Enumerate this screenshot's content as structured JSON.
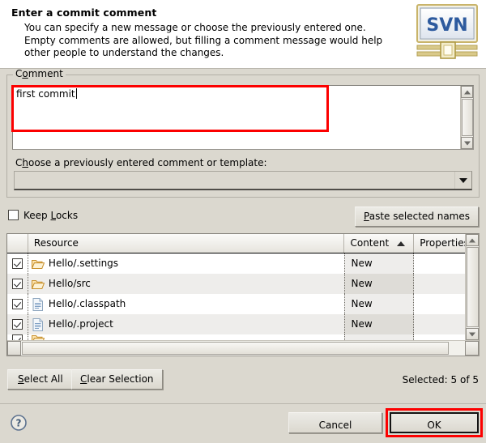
{
  "dialog": {
    "title": "Enter a commit comment",
    "description_lines": [
      "You can specify a new message or choose the previously entered one.",
      "Empty comments are allowed, but filling a comment message would help",
      "other people to understand the changes."
    ],
    "logo_text": "SVN"
  },
  "comment_group": {
    "label_pre": "C",
    "label_mnemonic": "o",
    "label_post": "mment",
    "label_full": "Comment",
    "value": "first commit"
  },
  "choose": {
    "label_pre": "C",
    "label_mnemonic": "h",
    "label_post": "oose a previously entered comment or template:",
    "label_full": "Choose a previously entered comment or template:",
    "selected_value": ""
  },
  "keep_locks": {
    "label_pre": "Keep ",
    "label_mnemonic": "L",
    "label_post": "ocks",
    "label_full": "Keep Locks",
    "checked": false
  },
  "paste_button": {
    "label_pre": "",
    "label_mnemonic": "P",
    "label_post": "aste selected names",
    "label_full": "Paste selected names"
  },
  "table": {
    "columns": [
      {
        "key": "check",
        "label": ""
      },
      {
        "key": "resource",
        "label": "Resource"
      },
      {
        "key": "content",
        "label": "Content",
        "sorted": "asc"
      },
      {
        "key": "properties",
        "label": "Properties"
      }
    ],
    "rows": [
      {
        "checked": true,
        "icon": "folder-icon",
        "resource": "Hello/.settings",
        "content": "New",
        "properties": ""
      },
      {
        "checked": true,
        "icon": "folder-icon",
        "resource": "Hello/src",
        "content": "New",
        "properties": ""
      },
      {
        "checked": true,
        "icon": "file-icon",
        "resource": "Hello/.classpath",
        "content": "New",
        "properties": ""
      },
      {
        "checked": true,
        "icon": "file-icon",
        "resource": "Hello/.project",
        "content": "New",
        "properties": ""
      },
      {
        "checked": true,
        "icon": "folder-icon",
        "resource": "",
        "content": "",
        "properties": ""
      }
    ]
  },
  "selection_bar": {
    "select_all_pre": "",
    "select_all_mnemonic": "S",
    "select_all_post": "elect All",
    "select_all_full": "Select All",
    "clear_pre": "",
    "clear_mnemonic": "C",
    "clear_post": "lear Selection",
    "clear_full": "Clear Selection",
    "status": "Selected: 5 of 5"
  },
  "footer": {
    "help_icon": "question-mark-icon",
    "cancel_label": "Cancel",
    "ok_label": "OK"
  },
  "colors": {
    "dialog_background": "#dbd8cf",
    "header_background": "#ffffff",
    "highlight_red": "#fc0000",
    "folder_icon": "#e0a33c",
    "file_icon": "#9bb7d4",
    "row_alt": "#eeedeb",
    "sorted_column": "#dedcd7"
  }
}
